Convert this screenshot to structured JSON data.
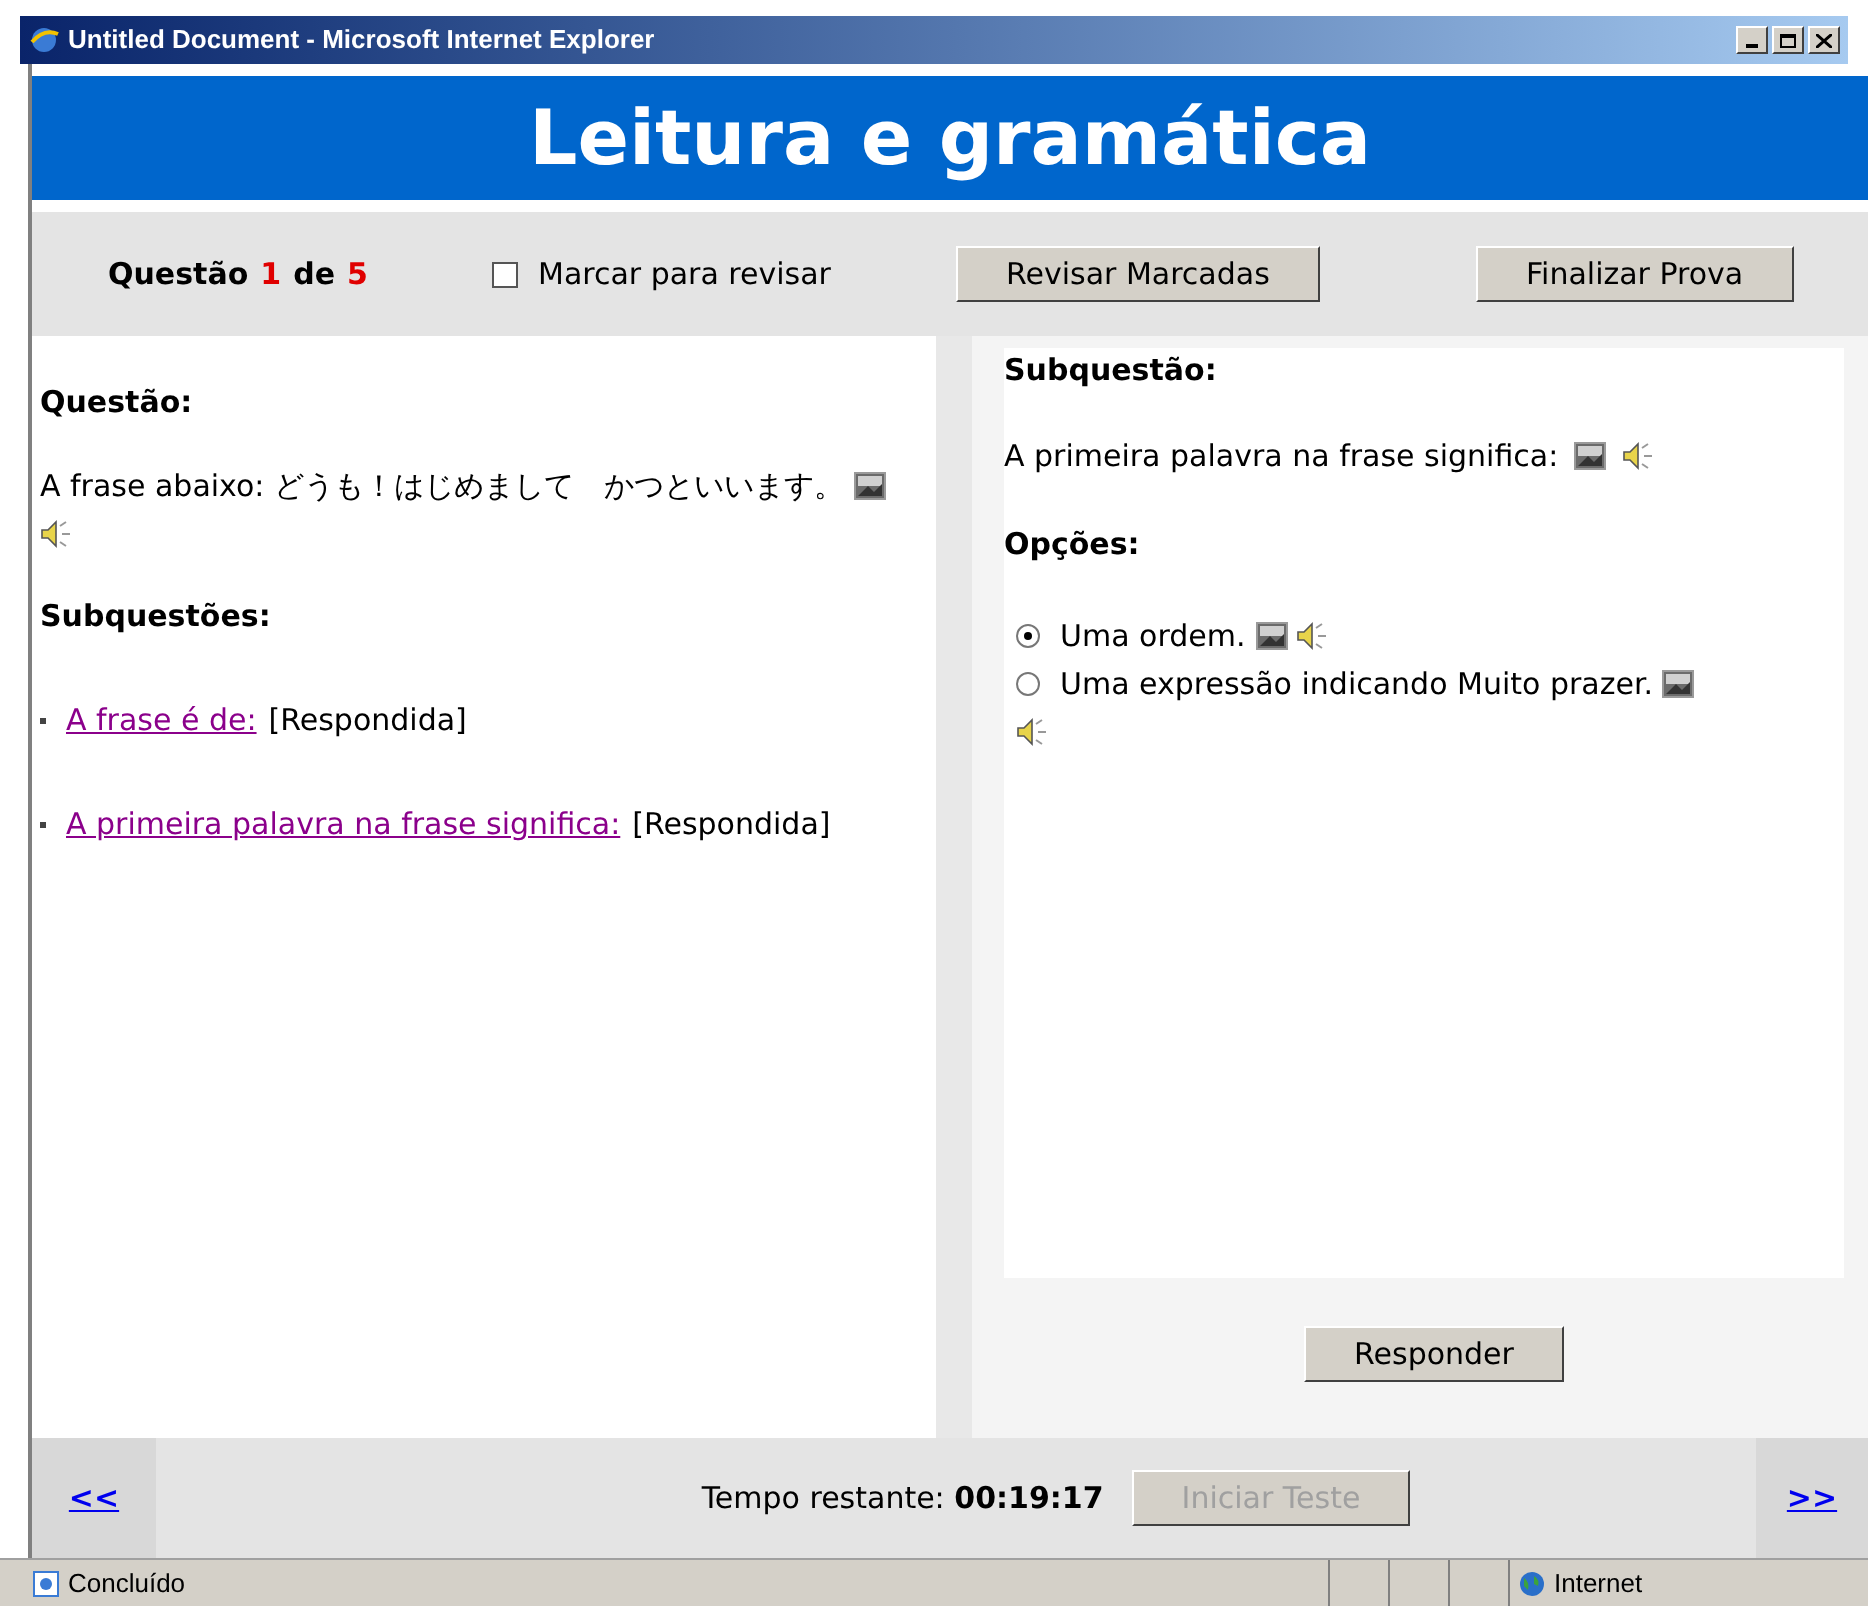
{
  "window": {
    "title": "Untitled Document - Microsoft Internet Explorer"
  },
  "header": {
    "title": "Leitura e gramática"
  },
  "toolbar": {
    "question_label": "Questão",
    "question_current": "1",
    "question_of": "de",
    "question_total": "5",
    "mark_for_review": {
      "label": "Marcar para revisar",
      "checked": false
    },
    "buttons": [
      {
        "label": "Revisar Marcadas",
        "disabled": false
      },
      {
        "label": "Finalizar Prova",
        "disabled": false
      }
    ]
  },
  "question_panel": {
    "heading": "Questão:",
    "text": "A frase abaixo: どうも！はじめまして　かつといいます。",
    "subquestions_heading": "Subquestões:",
    "subquestions": [
      {
        "link": "A frase é de:",
        "status": "[Respondida]"
      },
      {
        "link": "A primeira palavra na frase significa:",
        "status": "[Respondida]"
      }
    ]
  },
  "subquestion_panel": {
    "heading": "Subquestão:",
    "text": "A primeira palavra na frase significa:",
    "options_heading": "Opções:",
    "options": [
      {
        "label": "Uma ordem.",
        "selected": true
      },
      {
        "label": "Uma expressão indicando Muito prazer.",
        "selected": false
      }
    ],
    "answer_button": {
      "label": "Responder",
      "disabled": false
    }
  },
  "footer": {
    "prev": "<<",
    "time_label": "Tempo restante:",
    "time": "00:19:17",
    "start_button": {
      "label": "Iniciar Teste",
      "disabled": true
    },
    "next": ">>"
  },
  "status_bar": {
    "status": "Concluído",
    "zone": "Internet"
  }
}
